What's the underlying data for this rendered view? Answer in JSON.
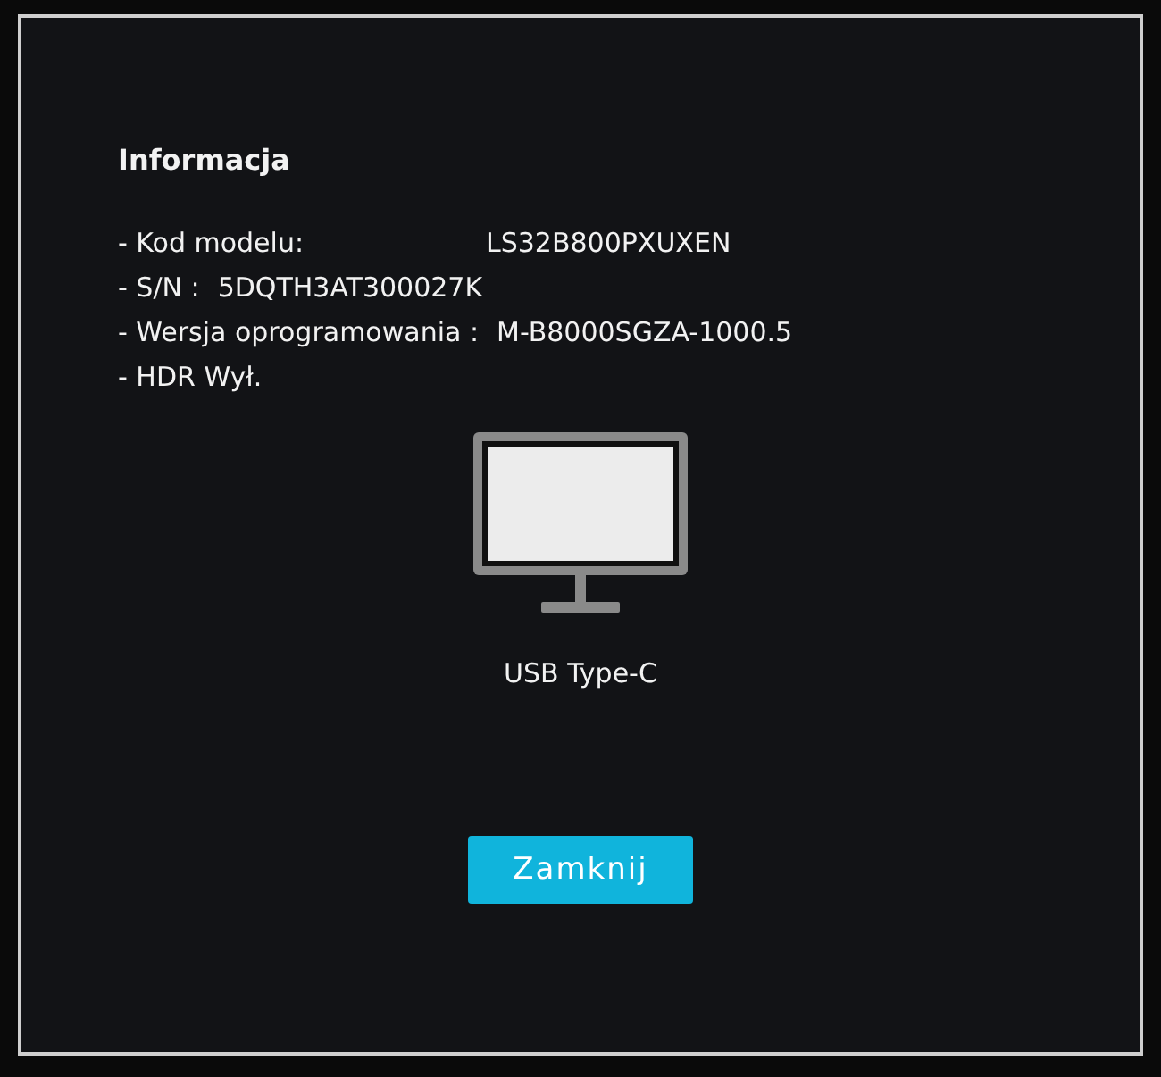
{
  "dialog": {
    "title": "Informacja",
    "info": [
      {
        "kind": "tabbed",
        "label": "- Kod modelu:",
        "value": "LS32B800PXUXEN"
      },
      {
        "kind": "inline",
        "label": "- S/N :",
        "value": "5DQTH3AT300027K"
      },
      {
        "kind": "inline",
        "label": "- Wersja oprogramowania :",
        "value": "M-B8000SGZA-1000.5"
      },
      {
        "kind": "inline",
        "label": "- HDR Wył."
      }
    ],
    "source": "USB Type-C",
    "close_button": "Zamknij"
  }
}
